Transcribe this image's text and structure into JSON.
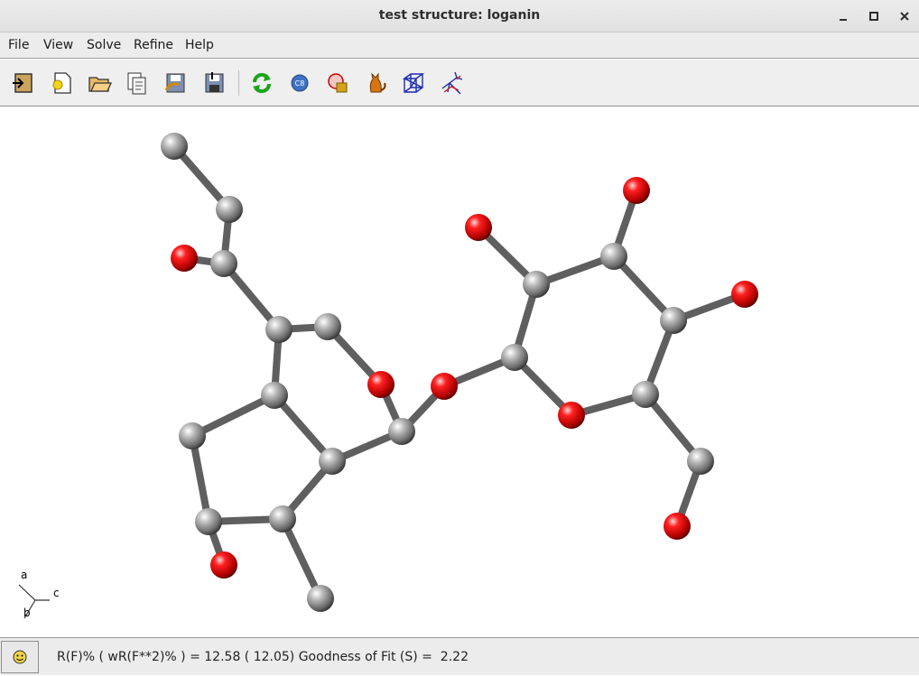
{
  "window": {
    "title": "test structure: loganin",
    "minimize_icon": "minimize-icon",
    "maximize_icon": "maximize-icon",
    "close_icon": "close-icon"
  },
  "menu": {
    "items": [
      "File",
      "View",
      "Solve",
      "Refine",
      "Help"
    ]
  },
  "toolbar": {
    "icons": [
      "import-icon",
      "new-structure-icon",
      "open-folder-icon",
      "report-icon",
      "save-as-icon",
      "save-icon",
      "refresh-icon",
      "cell-icon",
      "shelx-icon",
      "cat-icon",
      "unit-cell-icon",
      "tree-icon"
    ]
  },
  "axes": {
    "a": "a",
    "b": "b",
    "c": "c"
  },
  "molecule": {
    "carbon_color": "#8a8a8a",
    "oxygen_color": "#e00000",
    "bond_color": "#5f5f5f"
  },
  "status": {
    "icon": "smiley-icon",
    "text": "R(F)% ( wR(F**2)% ) = 12.58 ( 12.05) Goodness of Fit (S) =  2.22"
  }
}
